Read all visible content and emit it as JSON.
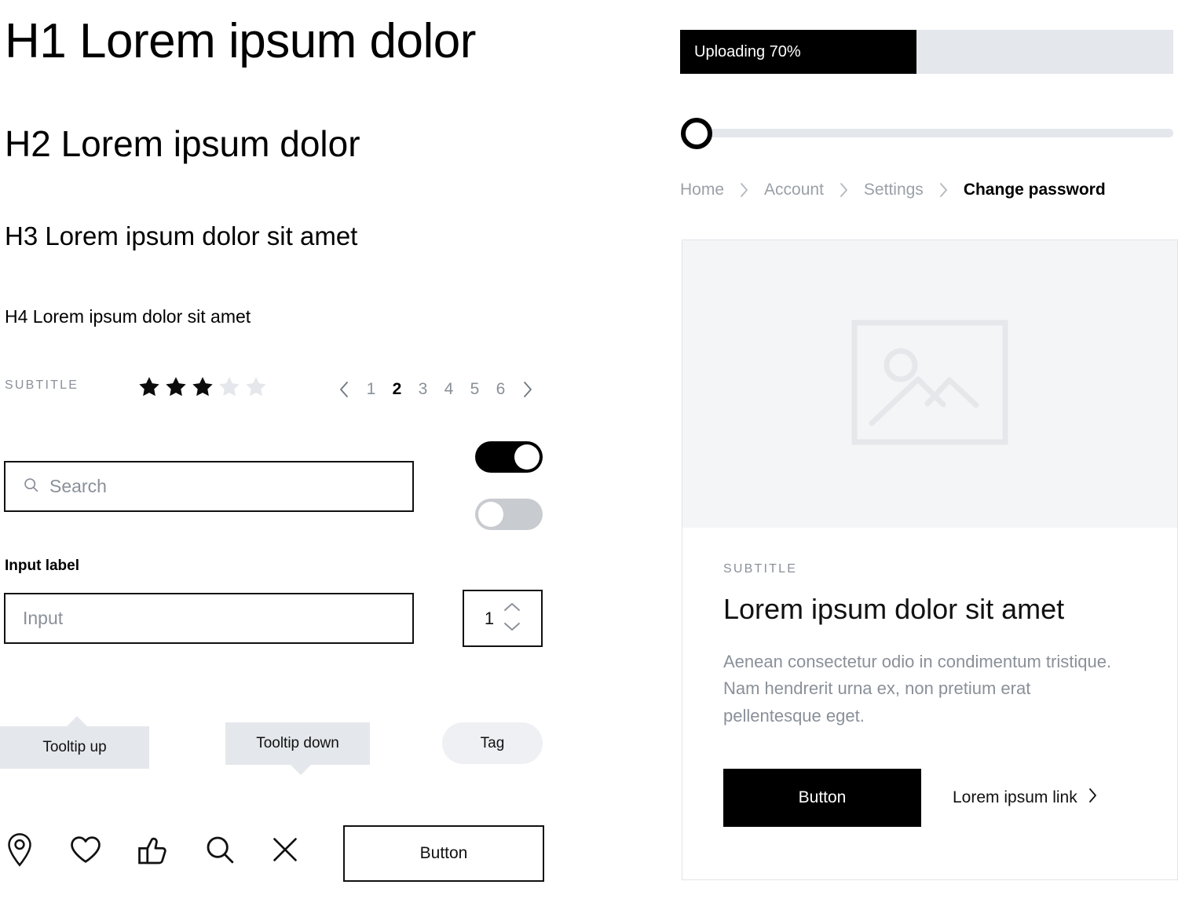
{
  "left": {
    "headings": {
      "h1": "H1 Lorem ipsum dolor",
      "h2": "H2 Lorem ipsum dolor",
      "h3": "H3 Lorem ipsum dolor sit amet",
      "h4": "H4 Lorem ipsum dolor sit amet"
    },
    "subtitle": "SUBTITLE",
    "rating": {
      "filled": 3,
      "total": 5,
      "filled_color": "#0c0c0c",
      "empty_color": "#e4e7eb"
    },
    "pagination": {
      "prev_icon": "chevron-left-icon",
      "next_icon": "chevron-right-icon",
      "pages": [
        "1",
        "2",
        "3",
        "4",
        "5",
        "6"
      ],
      "active": "2"
    },
    "search": {
      "icon": "search-icon",
      "placeholder": "Search",
      "value": ""
    },
    "toggles": {
      "on_label": "toggle-on",
      "off_label": "toggle-off"
    },
    "input": {
      "label": "Input label",
      "placeholder": "Input",
      "value": ""
    },
    "stepper": {
      "value": "1",
      "up_icon": "chevron-up-icon",
      "down_icon": "chevron-down-icon"
    },
    "tooltips": {
      "up": "Tooltip up",
      "down": "Tooltip down"
    },
    "tag": "Tag",
    "icons": [
      "map-pin-icon",
      "heart-icon",
      "thumbs-up-icon",
      "search-icon",
      "close-icon"
    ],
    "button_outline": "Button"
  },
  "right": {
    "progress": {
      "label": "Uploading 70%",
      "percent": 70,
      "fill_width_pct": 48,
      "fill_color": "#000000",
      "track_color": "#e4e7eb"
    },
    "slider": {
      "value": 0,
      "knob_color": "#000000",
      "track_color": "#e4e7eb"
    },
    "breadcrumb": {
      "separator_icon": "chevron-right-icon",
      "items": [
        {
          "label": "Home",
          "current": false
        },
        {
          "label": "Account",
          "current": false
        },
        {
          "label": "Settings",
          "current": false
        },
        {
          "label": "Change password",
          "current": true
        }
      ]
    },
    "card": {
      "media_icon": "image-placeholder-icon",
      "subtitle": "SUBTITLE",
      "title": "Lorem ipsum dolor sit amet",
      "text": "Aenean consectetur odio in condimentum tristique. Nam hendrerit urna ex, non pretium erat pellentesque eget.",
      "button": "Button",
      "link": "Lorem ipsum link",
      "link_icon": "chevron-right-icon"
    }
  }
}
